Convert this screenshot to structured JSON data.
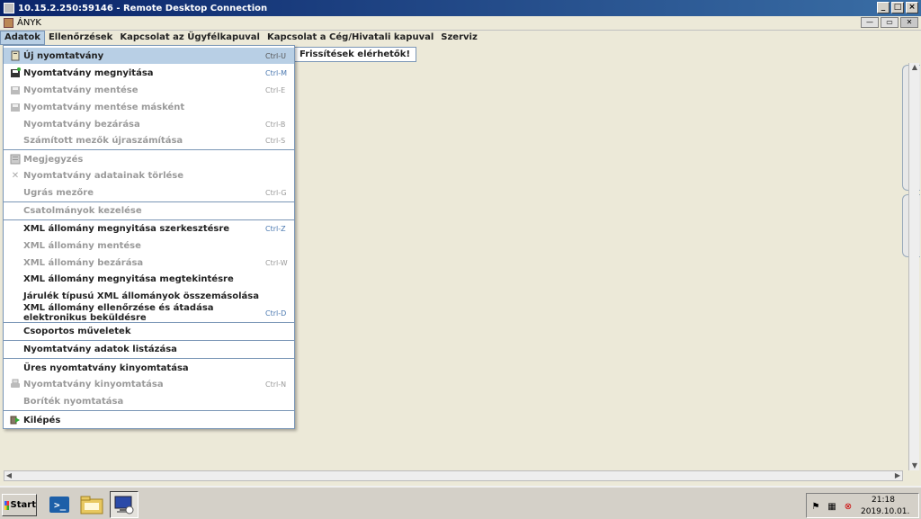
{
  "rdp": {
    "title": "10.15.2.250:59146 - Remote Desktop Connection"
  },
  "app": {
    "title": "ÁNYK"
  },
  "menubar": [
    "Adatok",
    "Ellenőrzések",
    "Kapcsolat az Ügyfélkapuval",
    "Kapcsolat a Cég/Hivatali kapuval",
    "Szerviz"
  ],
  "toolbar": {
    "update_label": "Frissítések elérhetők!"
  },
  "dropdown": [
    {
      "label": "Új nyomtatvány",
      "shortcut": "Ctrl-U",
      "icon": "new-doc-icon",
      "state": "highlighted"
    },
    {
      "label": "Nyomtatvány megnyitása",
      "shortcut": "Ctrl-M",
      "icon": "open-doc-icon",
      "state": "enabled"
    },
    {
      "label": "Nyomtatvány mentése",
      "shortcut": "Ctrl-E",
      "icon": "save-icon",
      "state": "disabled"
    },
    {
      "label": "Nyomtatvány mentése másként",
      "shortcut": "",
      "icon": "save-as-icon",
      "state": "disabled"
    },
    {
      "label": "Nyomtatvány bezárása",
      "shortcut": "Ctrl-B",
      "icon": "",
      "state": "disabled"
    },
    {
      "label": "Számított mezők újraszámítása",
      "shortcut": "Ctrl-S",
      "icon": "",
      "state": "disabled"
    },
    {
      "label": "Megjegyzés",
      "shortcut": "",
      "icon": "note-icon",
      "state": "disabled"
    },
    {
      "label": "Nyomtatvány adatainak törlése",
      "shortcut": "",
      "icon": "delete-icon",
      "state": "disabled"
    },
    {
      "label": "Ugrás mezőre",
      "shortcut": "Ctrl-G",
      "icon": "",
      "state": "disabled"
    },
    {
      "label": "Csatolmányok kezelése",
      "shortcut": "",
      "icon": "",
      "state": "disabled"
    },
    {
      "label": "XML állomány megnyitása szerkesztésre",
      "shortcut": "Ctrl-Z",
      "icon": "",
      "state": "enabled"
    },
    {
      "label": "XML állomány mentése",
      "shortcut": "",
      "icon": "",
      "state": "disabled"
    },
    {
      "label": "XML állomány bezárása",
      "shortcut": "Ctrl-W",
      "icon": "",
      "state": "disabled"
    },
    {
      "label": "XML állomány megnyitása megtekintésre",
      "shortcut": "",
      "icon": "",
      "state": "enabled"
    },
    {
      "label": "Járulék típusú XML állományok összemásolása",
      "shortcut": "",
      "icon": "",
      "state": "enabled"
    },
    {
      "label": "XML állomány ellenőrzése és átadása elektronikus beküldésre",
      "shortcut": "Ctrl-D",
      "icon": "",
      "state": "enabled"
    },
    {
      "label": "Csoportos műveletek",
      "shortcut": "",
      "icon": "",
      "state": "enabled"
    },
    {
      "label": "Nyomtatvány adatok listázása",
      "shortcut": "",
      "icon": "",
      "state": "enabled"
    },
    {
      "label": "Üres nyomtatvány kinyomtatása",
      "shortcut": "",
      "icon": "",
      "state": "enabled"
    },
    {
      "label": "Nyomtatvány kinyomtatása",
      "shortcut": "Ctrl-N",
      "icon": "printer-icon",
      "state": "disabled"
    },
    {
      "label": "Boríték nyomtatása",
      "shortcut": "",
      "icon": "",
      "state": "disabled"
    },
    {
      "label": "Kilépés",
      "shortcut": "",
      "icon": "exit-icon",
      "state": "enabled"
    }
  ],
  "taskbar": {
    "start_label": "Start",
    "clock_time": "21:18",
    "clock_date": "2019.10.01."
  }
}
